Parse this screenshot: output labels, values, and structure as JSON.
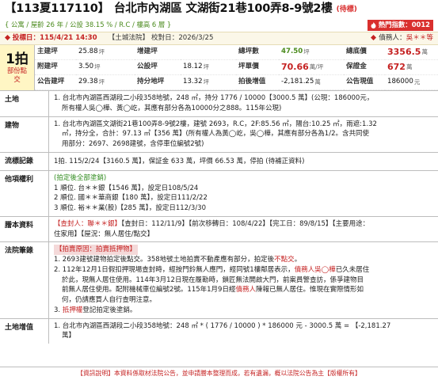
{
  "header": {
    "case_id": "【113夏117110】",
    "address": "台北市內湖區 文湖街21巷100弄8-9號2樓",
    "status_tag": "(待標)"
  },
  "specs": {
    "text": "{ 公寓 / 屋齡 26 年 / 公設 38.15 % / R.C / 樓高 6 層 }",
    "hot_label": "熱門指數：",
    "hot_value": "0012"
  },
  "bid": {
    "bid_label": "投標日：",
    "bid_date": "115/4/21 14:30",
    "land_tag": "【土城法院】",
    "check_label": "校對日：",
    "check_date": "2026/3/25",
    "debtor_label": "債務人：",
    "debtor_value": "吳＊＊等"
  },
  "summary": {
    "lot_number": "1拍",
    "lot_note": "部份點交",
    "rows": [
      {
        "a_label": "主建坪",
        "a_value": "25.88",
        "a_unit": "坪",
        "b_label": "增建坪",
        "b_value": "",
        "b_unit": "",
        "c_label": "總坪數",
        "c_value": "47.50",
        "c_unit": "坪",
        "d_label": "總底價",
        "d_value": "3356.5",
        "d_unit": "萬"
      },
      {
        "a_label": "附建坪",
        "a_value": "3.50",
        "a_unit": "坪",
        "b_label": "公設坪",
        "b_value": "18.12",
        "b_unit": "坪",
        "c_label": "坪單價",
        "c_value": "70.66",
        "c_unit": "萬/坪",
        "d_label": "保證金",
        "d_value": "672",
        "d_unit": "萬"
      },
      {
        "a_label": "公告建坪",
        "a_value": "29.38",
        "a_unit": "坪",
        "b_label": "持分地坪",
        "b_value": "13.32",
        "b_unit": "坪",
        "c_label": "拍後增值",
        "c_value": "-2,181.25",
        "c_unit": "萬",
        "d_label": "公告現值",
        "d_value": "186000",
        "d_unit": "元"
      }
    ]
  },
  "sections": {
    "land": {
      "label": "土地",
      "line1": "1. 台北市內湖區西湖段二小段358地號，248 ㎡，持分 1776 / 10000【3000.5 萬】(公現：186000元，",
      "line2": "所有權人吳◯樺、黃◯屹，其應有部分各為10000分之888。115年公現)"
    },
    "building": {
      "label": "建物",
      "line1": "1. 台北市內湖區文湖街21巷100弄8-9號2樓，建號 2693，R.C，2F:85.56 ㎡，陽台:10.25 ㎡，雨遮:1.32",
      "line2": "㎡，持分全，合計：97.13 ㎡【356 萬】(所有權人為黃◯屹，吳◯樺，其應有部分各為1/2。含共同使",
      "line3": "用部分：2697、2698建號，含停車位編號2號)"
    },
    "auction": {
      "label": "流標記錄",
      "text": "1拍. 115/2/24【3160.5 萬】，保証金 633 萬，坪價 66.53 萬，停拍 (待補正資料)"
    },
    "rights": {
      "label": "他項權利",
      "heading": "(拍定後全部塗銷)",
      "items": [
        "1 順位. 台＊＊銀【1546 萬】，設定日108/5/24",
        "2 順位. 國＊＊華商銀【180 萬】，設定日111/2/22",
        "3 順位. 裕＊＊業(股)【285 萬】，設定日112/3/30"
      ]
    },
    "lease": {
      "label": "謄本資料",
      "line1_red": "【查封人：聯＊＊銀】",
      "line1_rest": "【查封日：112/11/9】【前次移轉日：108/4/22】【完工日：89/8/15】【主要用途：",
      "line2": "住家用】【屋況：無人居住/點交】"
    },
    "court": {
      "label": "法院筆錄",
      "reason": "【拍賣原因：拍賣抵押物】",
      "item1_prefix": "1. 2693建號建物拍定後點交。358地號土地拍賣不動產應有部分，拍定後",
      "item1_red": "不點交",
      "item1_suffix": "。",
      "item2_a": "2. 112年12月1日假扣押現場查封時，經按門鈴無人應門，經同號1樓鄰居表示，",
      "item2_red1": "債務人吳◯樺",
      "item2_b": "已久未居住",
      "item2_c": "於此，現無人居住使用。114年3月12日現在履勘時，鎖匠無法開啟大門，前案員警查訪，係爭建物目",
      "item2_d": "前無人居住使用。配附機械車位編號2號。115年1月9日經",
      "item2_red2": "債務人",
      "item2_e": "陳報已無人居住。惟現在實際情形如",
      "item2_f": "何，仍請應買人自行查明注意。",
      "item3_a": "3. ",
      "item3_red": "抵押權",
      "item3_b": "登記拍定後塗銷。"
    },
    "value": {
      "label": "土地增值",
      "line1": "1. 台北市內湖區西湖段二小段358地號：248 ㎡ * ( 1776 / 10000 ) * 186000 元 - 3000.5 萬 = 【-2,181.27",
      "line2": "萬】"
    }
  },
  "footer": {
    "text": "【資訊說明】本資料係取材法院公告，並申請謄本整理而成，若有遺漏，概以法院公告為主【版權所有】"
  },
  "colors": {
    "accent_red": "#c52222",
    "accent_green": "#4a8a1c",
    "badge_red": "#d9302e"
  }
}
